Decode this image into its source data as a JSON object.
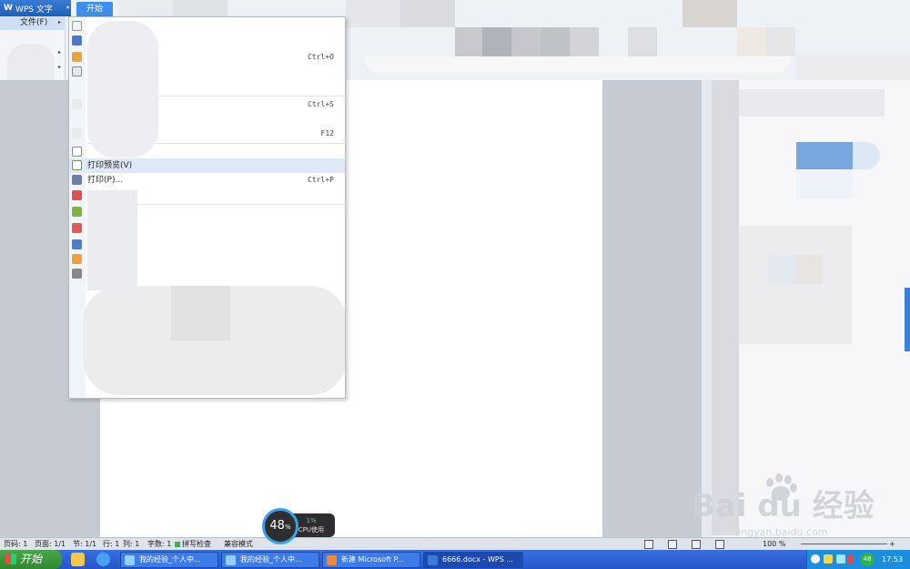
{
  "app": {
    "button_label": "WPS 文字",
    "tab_start": "开始"
  },
  "file_menu": {
    "label": "文件(F)"
  },
  "menu": {
    "items": [
      {
        "label": "",
        "shortcut": ""
      },
      {
        "label": "",
        "shortcut": ""
      },
      {
        "label": "",
        "shortcut": "Ctrl+O"
      },
      {
        "label": "",
        "shortcut": ""
      },
      {
        "label": "",
        "shortcut": "Ctrl+S"
      },
      {
        "label": "",
        "shortcut": "F12"
      },
      {
        "label": "",
        "shortcut": ""
      },
      {
        "label": "打印预览(V)",
        "shortcut": ""
      },
      {
        "label": "打印(P)...",
        "shortcut": "Ctrl+P"
      }
    ]
  },
  "statusbar": {
    "page_code": "页码: 1",
    "pages": "页面: 1/1",
    "section": "节: 1/1",
    "row": "行: 1",
    "col": "列: 1",
    "word_count": "字数: 1",
    "spell_check": "拼写检查",
    "compat_mode": "兼容模式",
    "zoom": "100 %"
  },
  "cpu_widget": {
    "percent": "48",
    "percent_unit": "%",
    "cpu_small_pct": "1%",
    "cpu_label": "CPU使用"
  },
  "taskbar": {
    "start_label": "开始",
    "tasks": [
      {
        "label": "我的经验_个人中...",
        "active": false
      },
      {
        "label": "我的经验_个人中...",
        "active": false
      },
      {
        "label": "新建 Microsoft P...",
        "active": false
      },
      {
        "label": "6666.docx - WPS ...",
        "active": true
      }
    ],
    "tray_badge": "48",
    "clock": "17:53"
  },
  "watermark": {
    "logo": "Bai du 经验",
    "url": "jingyan.baidu.com"
  },
  "colors": {
    "ribbon_bg": "#eef1f6",
    "accent_blue": "#3f8ee8",
    "taskbar_blue": "#2456c9",
    "start_green": "#3aa03a"
  }
}
